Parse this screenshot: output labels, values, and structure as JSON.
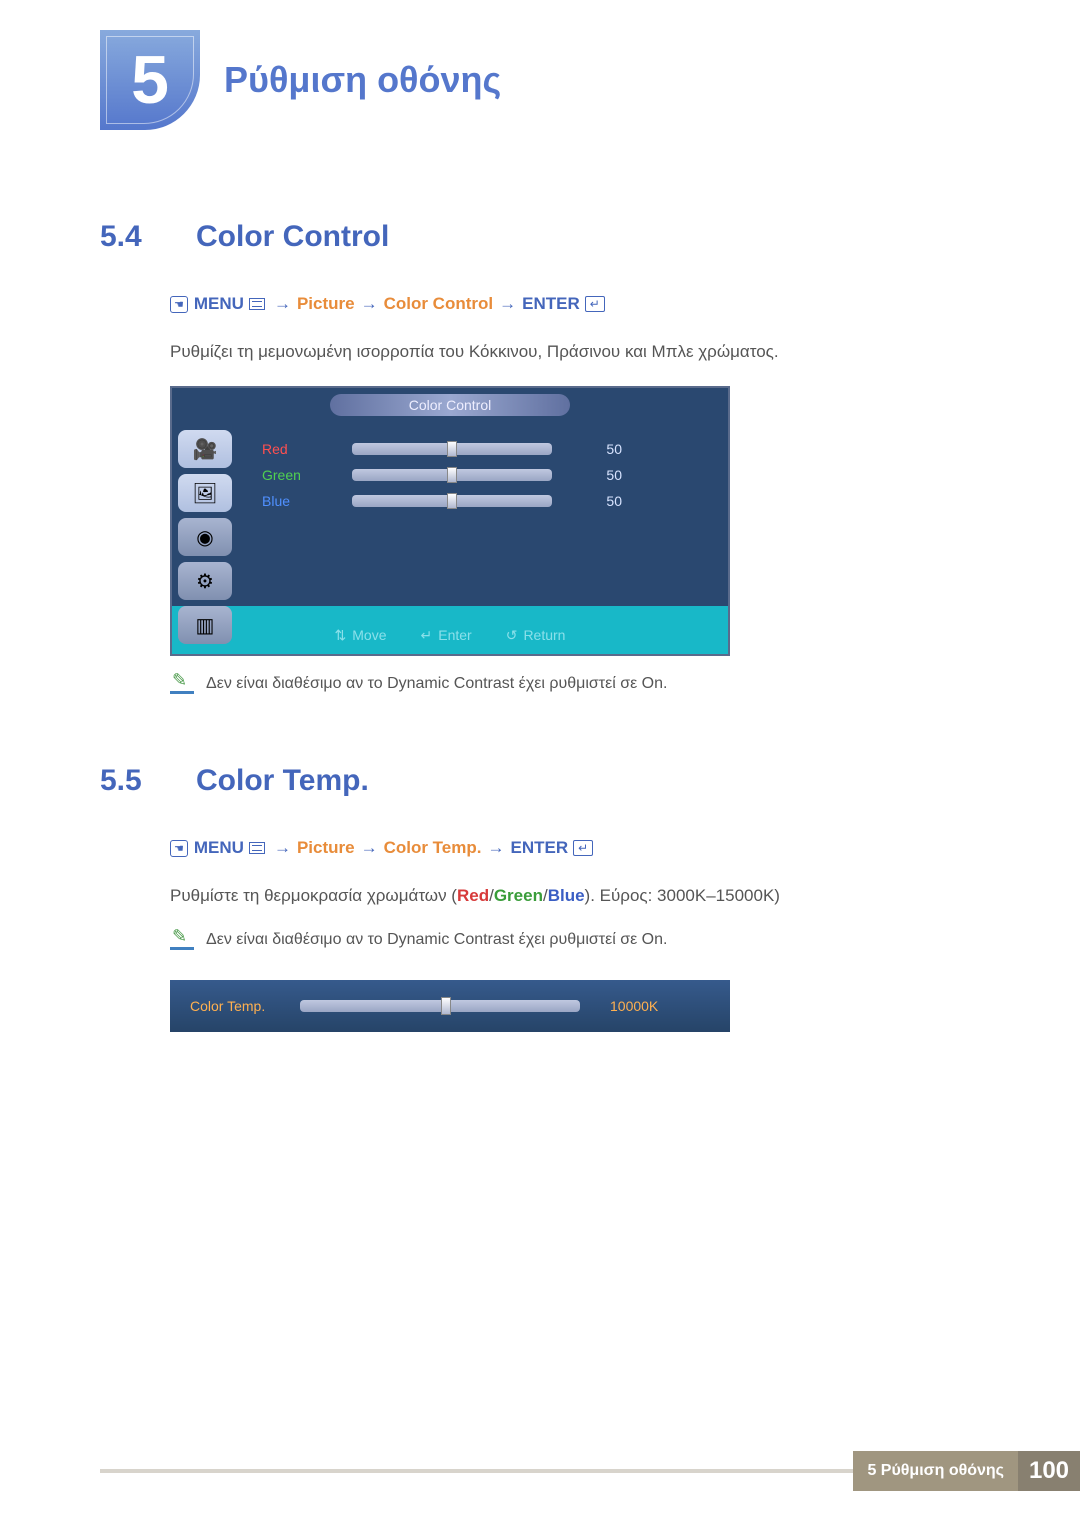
{
  "chapter": {
    "number": "5",
    "title": "Ρύθμιση οθόνης"
  },
  "section54": {
    "num": "5.4",
    "title": "Color Control",
    "breadcrumb": {
      "menu": "MENU",
      "path1": "Picture",
      "path2": "Color Control",
      "enter": "ENTER"
    },
    "description": "Ρυθμίζει τη μεμονωμένη ισορροπία του Κόκκινου, Πράσινου και Μπλε χρώματος.",
    "osd": {
      "title": "Color Control",
      "rows": {
        "red": {
          "label": "Red",
          "value": "50"
        },
        "green": {
          "label": "Green",
          "value": "50"
        },
        "blue": {
          "label": "Blue",
          "value": "50"
        }
      },
      "footer": {
        "move": "Move",
        "enter": "Enter",
        "return": "Return"
      }
    },
    "note_pre": "Δεν είναι διαθέσιμο αν το ",
    "note_dc": "Dynamic Contrast",
    "note_mid": " έχει ρυθμιστεί σε ",
    "note_on": "On",
    "note_post": "."
  },
  "section55": {
    "num": "5.5",
    "title": "Color Temp.",
    "breadcrumb": {
      "menu": "MENU",
      "path1": "Picture",
      "path2": "Color Temp.",
      "enter": "ENTER"
    },
    "desc_pre": "Ρυθμίστε τη θερμοκρασία χρωμάτων (",
    "desc_red": "Red",
    "desc_sep": "/",
    "desc_green": "Green",
    "desc_blue": "Blue",
    "desc_post": "). Εύρος: 3000K–15000K)",
    "note_pre": "Δεν είναι διαθέσιμο αν το ",
    "note_dc": "Dynamic Contrast",
    "note_mid": " έχει ρυθμιστεί σε ",
    "note_on": "On",
    "note_post": ".",
    "osd": {
      "label": "Color Temp.",
      "value": "10000K"
    }
  },
  "footer": {
    "text": "5 Ρύθμιση οθόνης",
    "page": "100"
  }
}
